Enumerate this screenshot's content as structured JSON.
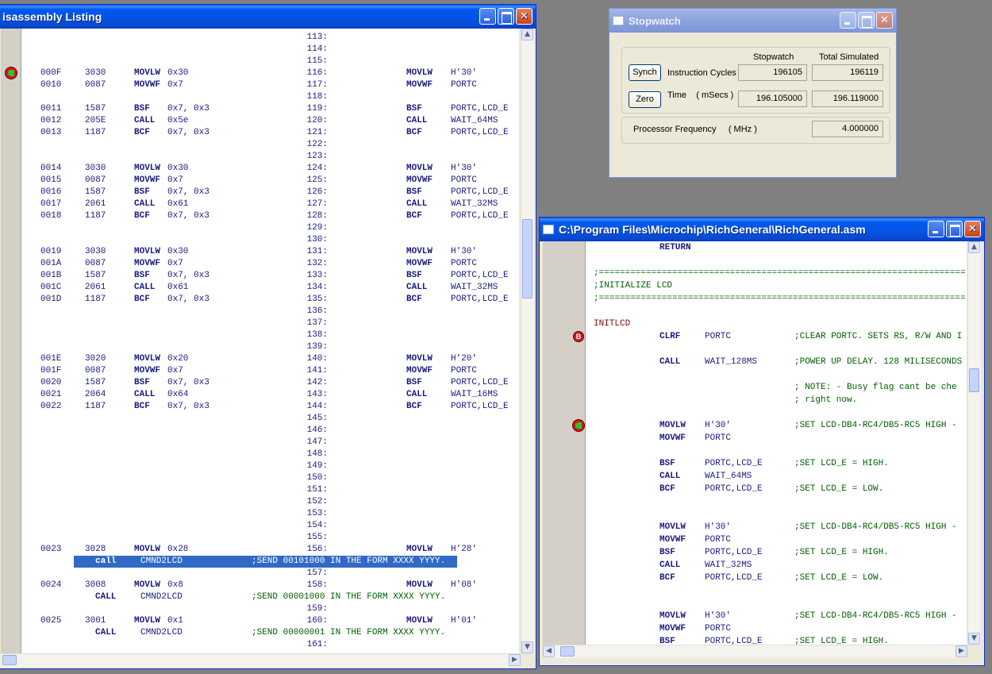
{
  "disasm": {
    "title": "isassembly Listing",
    "lines": [
      {
        "ln": "113:"
      },
      {
        "ln": "114:"
      },
      {
        "ln": "115:"
      },
      {
        "addr": "000F",
        "op": "3030",
        "mn": "MOVLW",
        "arg": "0x30",
        "ln": "116:",
        "smn": "MOVLW",
        "sarg": "H'30'",
        "marker": true
      },
      {
        "addr": "0010",
        "op": "0087",
        "mn": "MOVWF",
        "arg": "0x7",
        "ln": "117:",
        "smn": "MOVWF",
        "sarg": "PORTC"
      },
      {
        "ln": "118:"
      },
      {
        "addr": "0011",
        "op": "1587",
        "mn": "BSF",
        "arg": "0x7, 0x3",
        "ln": "119:",
        "smn": "BSF",
        "sarg": "PORTC,LCD_E"
      },
      {
        "addr": "0012",
        "op": "205E",
        "mn": "CALL",
        "arg": "0x5e",
        "ln": "120:",
        "smn": "CALL",
        "sarg": "WAIT_64MS"
      },
      {
        "addr": "0013",
        "op": "1187",
        "mn": "BCF",
        "arg": "0x7, 0x3",
        "ln": "121:",
        "smn": "BCF",
        "sarg": "PORTC,LCD_E"
      },
      {
        "ln": "122:"
      },
      {
        "ln": "123:"
      },
      {
        "addr": "0014",
        "op": "3030",
        "mn": "MOVLW",
        "arg": "0x30",
        "ln": "124:",
        "smn": "MOVLW",
        "sarg": "H'30'"
      },
      {
        "addr": "0015",
        "op": "0087",
        "mn": "MOVWF",
        "arg": "0x7",
        "ln": "125:",
        "smn": "MOVWF",
        "sarg": "PORTC"
      },
      {
        "addr": "0016",
        "op": "1587",
        "mn": "BSF",
        "arg": "0x7, 0x3",
        "ln": "126:",
        "smn": "BSF",
        "sarg": "PORTC,LCD_E"
      },
      {
        "addr": "0017",
        "op": "2061",
        "mn": "CALL",
        "arg": "0x61",
        "ln": "127:",
        "smn": "CALL",
        "sarg": "WAIT_32MS"
      },
      {
        "addr": "0018",
        "op": "1187",
        "mn": "BCF",
        "arg": "0x7, 0x3",
        "ln": "128:",
        "smn": "BCF",
        "sarg": "PORTC,LCD_E"
      },
      {
        "ln": "129:"
      },
      {
        "ln": "130:"
      },
      {
        "addr": "0019",
        "op": "3030",
        "mn": "MOVLW",
        "arg": "0x30",
        "ln": "131:",
        "smn": "MOVLW",
        "sarg": "H'30'"
      },
      {
        "addr": "001A",
        "op": "0087",
        "mn": "MOVWF",
        "arg": "0x7",
        "ln": "132:",
        "smn": "MOVWF",
        "sarg": "PORTC"
      },
      {
        "addr": "001B",
        "op": "1587",
        "mn": "BSF",
        "arg": "0x7, 0x3",
        "ln": "133:",
        "smn": "BSF",
        "sarg": "PORTC,LCD_E"
      },
      {
        "addr": "001C",
        "op": "2061",
        "mn": "CALL",
        "arg": "0x61",
        "ln": "134:",
        "smn": "CALL",
        "sarg": "WAIT_32MS"
      },
      {
        "addr": "001D",
        "op": "1187",
        "mn": "BCF",
        "arg": "0x7, 0x3",
        "ln": "135:",
        "smn": "BCF",
        "sarg": "PORTC,LCD_E"
      },
      {
        "ln": "136:"
      },
      {
        "ln": "137:"
      },
      {
        "ln": "138:"
      },
      {
        "ln": "139:"
      },
      {
        "addr": "001E",
        "op": "3020",
        "mn": "MOVLW",
        "arg": "0x20",
        "ln": "140:",
        "smn": "MOVLW",
        "sarg": "H'20'"
      },
      {
        "addr": "001F",
        "op": "0087",
        "mn": "MOVWF",
        "arg": "0x7",
        "ln": "141:",
        "smn": "MOVWF",
        "sarg": "PORTC"
      },
      {
        "addr": "0020",
        "op": "1587",
        "mn": "BSF",
        "arg": "0x7, 0x3",
        "ln": "142:",
        "smn": "BSF",
        "sarg": "PORTC,LCD_E"
      },
      {
        "addr": "0021",
        "op": "2064",
        "mn": "CALL",
        "arg": "0x64",
        "ln": "143:",
        "smn": "CALL",
        "sarg": "WAIT_16MS"
      },
      {
        "addr": "0022",
        "op": "1187",
        "mn": "BCF",
        "arg": "0x7, 0x3",
        "ln": "144:",
        "smn": "BCF",
        "sarg": "PORTC,LCD_E"
      },
      {
        "ln": "145:"
      },
      {
        "ln": "146:"
      },
      {
        "ln": "147:"
      },
      {
        "ln": "148:"
      },
      {
        "ln": "149:"
      },
      {
        "ln": "150:"
      },
      {
        "ln": "151:"
      },
      {
        "ln": "152:"
      },
      {
        "ln": "153:"
      },
      {
        "ln": "154:"
      },
      {
        "ln": "155:"
      },
      {
        "addr": "0023",
        "op": "3028",
        "mn": "MOVLW",
        "arg": "0x28",
        "ln": "156:",
        "smn": "MOVLW",
        "sarg": "H'28'"
      },
      {
        "src": true,
        "sel": true,
        "smn": "call",
        "sarg": "CMND2LCD",
        "cm": ";SEND 00101000 IN THE FORM XXXX YYYY."
      },
      {
        "ln": "157:"
      },
      {
        "addr": "0024",
        "op": "3008",
        "mn": "MOVLW",
        "arg": "0x8",
        "ln": "158:",
        "smn": "MOVLW",
        "sarg": "H'08'"
      },
      {
        "src": true,
        "smn": "CALL",
        "sarg": "CMND2LCD",
        "cm": ";SEND 00001000 IN THE FORM XXXX YYYY."
      },
      {
        "ln": "159:"
      },
      {
        "addr": "0025",
        "op": "3001",
        "mn": "MOVLW",
        "arg": "0x1",
        "ln": "160:",
        "smn": "MOVLW",
        "sarg": "H'01'"
      },
      {
        "src": true,
        "smn": "CALL",
        "sarg": "CMND2LCD",
        "cm": ";SEND 00000001 IN THE FORM XXXX YYYY."
      },
      {
        "ln": "161:"
      }
    ]
  },
  "stopwatch": {
    "title": "Stopwatch",
    "col_stopwatch": "Stopwatch",
    "col_total": "Total Simulated",
    "synch_label": "Synch",
    "zero_label": "Zero",
    "instr_label": "Instruction Cycles",
    "time_label": "Time    ( mSecs )",
    "cycles_stopwatch": "196105",
    "cycles_total": "196119",
    "time_stopwatch": "196.105000",
    "time_total": "196.119000",
    "freq_label": "Processor Frequency     ( MHz )",
    "freq_value": "4.000000"
  },
  "asm": {
    "title": "C:\\Program Files\\Microchip\\RichGeneral\\RichGeneral.asm",
    "lines": [
      {
        "ret": "RETURN"
      },
      {},
      {
        "full": ";======================================================================"
      },
      {
        "full": ";INITIALIZE LCD"
      },
      {
        "full": ";======================================================================"
      },
      {},
      {
        "label": "INITLCD"
      },
      {
        "mn": "CLRF",
        "arg": "PORTC",
        "cm": ";CLEAR PORTC. SETS RS, R/W AND I",
        "bp": true
      },
      {},
      {
        "mn": "CALL",
        "arg": "WAIT_128MS",
        "cm": ";POWER UP DELAY. 128 MILISECONDS"
      },
      {},
      {
        "cm": "; NOTE: - Busy flag cant be che"
      },
      {
        "cm": "; right now."
      },
      {},
      {
        "mn": "MOVLW",
        "arg": "H'30'",
        "cm": ";SET LCD-DB4-RC4/DB5-RC5 HIGH -",
        "marker": true
      },
      {
        "mn": "MOVWF",
        "arg": "PORTC"
      },
      {},
      {
        "mn": "BSF",
        "arg": "PORTC,LCD_E",
        "cm": ";SET LCD_E = HIGH."
      },
      {
        "mn": "CALL",
        "arg": "WAIT_64MS"
      },
      {
        "mn": "BCF",
        "arg": "PORTC,LCD_E",
        "cm": ";SET LCD_E = LOW."
      },
      {},
      {},
      {
        "mn": "MOVLW",
        "arg": "H'30'",
        "cm": ";SET LCD-DB4-RC4/DB5-RC5 HIGH -"
      },
      {
        "mn": "MOVWF",
        "arg": "PORTC"
      },
      {
        "mn": "BSF",
        "arg": "PORTC,LCD_E",
        "cm": ";SET LCD_E = HIGH."
      },
      {
        "mn": "CALL",
        "arg": "WAIT_32MS"
      },
      {
        "mn": "BCF",
        "arg": "PORTC,LCD_E",
        "cm": ";SET LCD_E = LOW."
      },
      {},
      {},
      {
        "mn": "MOVLW",
        "arg": "H'30'",
        "cm": ";SET LCD-DB4-RC4/DB5-RC5 HIGH -"
      },
      {
        "mn": "MOVWF",
        "arg": "PORTC"
      },
      {
        "mn": "BSF",
        "arg": "PORTC,LCD_E",
        "cm": ";SET LCD_E = HIGH."
      }
    ]
  },
  "icons": {
    "minimize": "minimize-icon",
    "maximize": "maximize-icon",
    "close": "close-icon",
    "scroll_up": "scroll-up-icon",
    "scroll_down": "scroll-down-icon",
    "scroll_left": "scroll-left-icon",
    "scroll_right": "scroll-right-icon",
    "pc_arrow": "program-counter-arrow-icon",
    "breakpoint": "breakpoint-icon"
  },
  "colors": {
    "selection": "#316ac5",
    "mnemonic": "#1a1a80",
    "comment": "#006000",
    "label": "#8b0000"
  }
}
